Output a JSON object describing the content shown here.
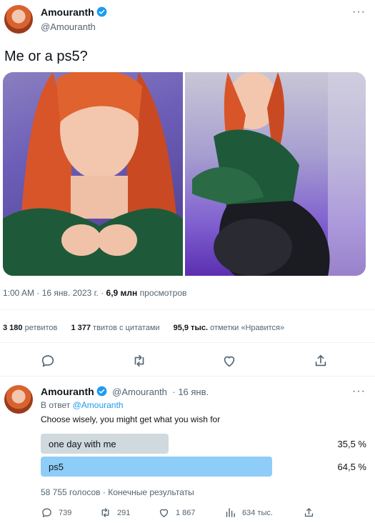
{
  "tweet": {
    "author_name": "Amouranth",
    "author_handle": "@Amouranth",
    "text": "Me or a ps5?",
    "time": "1:00 AM",
    "date": "16 янв. 2023 г.",
    "views_count": "6,9 млн",
    "views_label": "просмотров",
    "stats": [
      {
        "count": "3 180",
        "label": "ретвитов"
      },
      {
        "count": "1 377",
        "label": "твитов с цитатами"
      },
      {
        "count": "95,9 тыс.",
        "label": "отметки «Нравится»"
      }
    ],
    "actions": [
      "reply-icon",
      "retweet-icon",
      "like-icon",
      "share-icon"
    ]
  },
  "reply": {
    "author_name": "Amouranth",
    "author_handle": "@Amouranth",
    "date": "· 16 янв.",
    "reply_prefix": "В ответ",
    "reply_to": "@Amouranth",
    "text": "Choose wisely, you might get what you wish for",
    "poll": {
      "options": [
        {
          "label": "one day with me",
          "percent_text": "35,5 %",
          "percent": 35.5
        },
        {
          "label": "ps5",
          "percent_text": "64,5 %",
          "percent": 64.5
        }
      ],
      "votes": "58 755 голосов",
      "status": "Конечные результаты"
    },
    "actions": {
      "replies": "739",
      "retweets": "291",
      "likes": "1 867",
      "views": "634 тыс."
    }
  },
  "colors": {
    "accent": "#1d9bf0",
    "text_secondary": "#536471",
    "poll_winner": "#8ecdf7",
    "poll_loser": "#cfd9de"
  }
}
